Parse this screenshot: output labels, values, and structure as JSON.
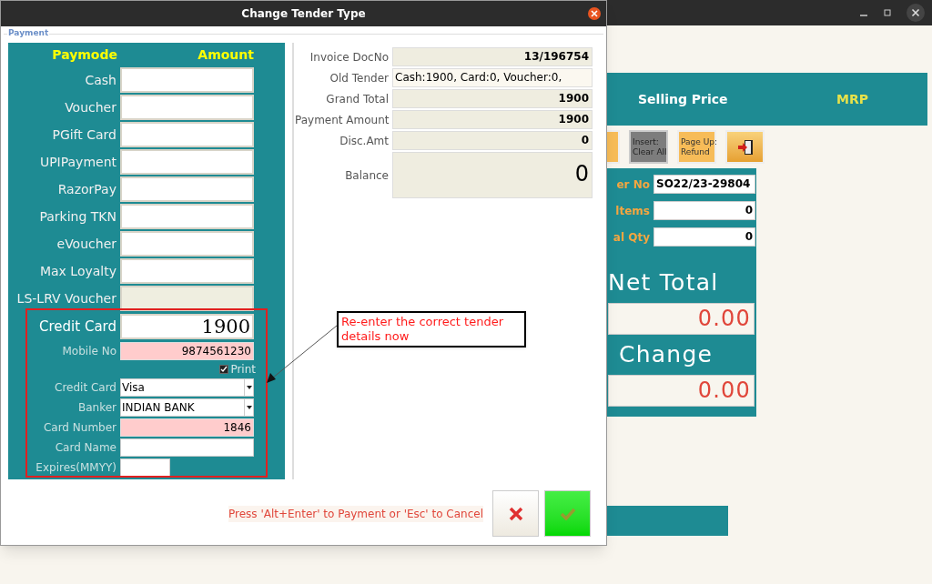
{
  "background_app": {
    "header_columns": [
      "Selling Price",
      "MRP"
    ],
    "buttons": [
      {
        "kind": "orange"
      },
      {
        "kind": "grey",
        "label": "Insert:\nClear All"
      },
      {
        "kind": "orange",
        "label": "Page Up:\nRefund"
      },
      {
        "kind": "exit"
      }
    ],
    "order_fields": [
      {
        "label": "er No",
        "value": "SO22/23-29804",
        "kind": "code"
      },
      {
        "label": "ltems",
        "value": "0",
        "kind": "count"
      },
      {
        "label": "al Qty",
        "value": "0",
        "kind": "count"
      }
    ],
    "totals": [
      {
        "label": "Net Total",
        "value": "0.00"
      },
      {
        "label": "Change",
        "value": "0.00"
      }
    ]
  },
  "dialog": {
    "title": "Change Tender Type",
    "group_label": "Payment",
    "paymode_header": "Paymode",
    "amount_header": "Amount",
    "paymodes": [
      {
        "label": "Cash",
        "disabled": false
      },
      {
        "label": "Voucher",
        "disabled": false
      },
      {
        "label": "PGift Card",
        "disabled": false
      },
      {
        "label": "UPIPayment",
        "disabled": false
      },
      {
        "label": "RazorPay",
        "disabled": false
      },
      {
        "label": "Parking TKN",
        "disabled": false
      },
      {
        "label": "eVoucher",
        "disabled": false
      },
      {
        "label": "Max Loyalty",
        "disabled": false
      },
      {
        "label": "LS-LRV Voucher",
        "disabled": true
      }
    ],
    "credit_card": {
      "label": "Credit Card",
      "amount": "1900"
    },
    "mobile": {
      "label": "Mobile No",
      "value": "9874561230"
    },
    "print": {
      "label": "Print",
      "checked": true
    },
    "card_details": [
      {
        "label": "Credit Card",
        "value": "Visa",
        "kind": "select"
      },
      {
        "label": "Banker",
        "value": "INDIAN BANK",
        "kind": "select"
      },
      {
        "label": "Card Number",
        "value": "1846",
        "kind": "required"
      },
      {
        "label": "Card Name",
        "kind": "plain"
      },
      {
        "label": "Expires(MMYY)",
        "kind": "short"
      }
    ],
    "info": [
      {
        "label": "Invoice DocNo",
        "value": "13/196754",
        "kind": "bold"
      },
      {
        "label": "Old Tender",
        "value": "Cash:1900, Card:0, Voucher:0,",
        "kind": "plain"
      },
      {
        "label": "Grand Total",
        "value": "1900",
        "kind": "bold"
      },
      {
        "label": "Payment Amount",
        "value": "1900",
        "kind": "bold"
      },
      {
        "label": "Disc.Amt",
        "value": "0",
        "kind": "bold"
      },
      {
        "label": "Balance",
        "value": "0",
        "kind": "large"
      }
    ],
    "hint": "Press 'Alt+Enter' to Payment or 'Esc' to Cancel",
    "annotation": "Re-enter the correct tender details now"
  }
}
